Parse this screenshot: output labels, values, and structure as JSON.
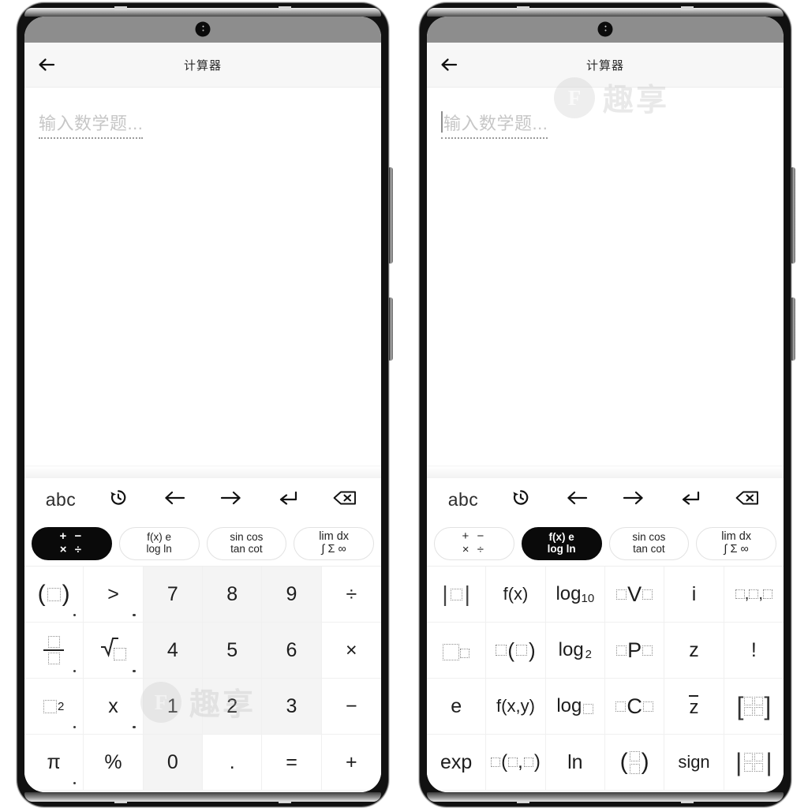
{
  "app": {
    "title": "计算器",
    "back_icon": "back-arrow-icon",
    "status_bar": {
      "camera": "front-camera-punch-hole"
    }
  },
  "input": {
    "placeholder": "输入数学题...",
    "value": "",
    "left_has_caret": false,
    "right_has_caret": true
  },
  "keyboard": {
    "nav": [
      {
        "id": "abc",
        "label": "abc",
        "icon": ""
      },
      {
        "id": "history",
        "label": "",
        "icon": "history-clock-icon"
      },
      {
        "id": "cursor-left",
        "label": "",
        "icon": "arrow-left-icon"
      },
      {
        "id": "cursor-right",
        "label": "",
        "icon": "arrow-right-icon"
      },
      {
        "id": "enter",
        "label": "",
        "icon": "enter-return-icon"
      },
      {
        "id": "backspace",
        "label": "",
        "icon": "backspace-delete-icon"
      }
    ],
    "categories": [
      {
        "id": "basic-ops",
        "line1": "+ −",
        "line2": "× ÷",
        "active_left": true,
        "active_right": false
      },
      {
        "id": "functions",
        "line1": "f(x)  e",
        "line2": "log  ln",
        "active_left": false,
        "active_right": true
      },
      {
        "id": "trig",
        "line1": "sin cos",
        "line2": "tan cot",
        "active_left": false,
        "active_right": false
      },
      {
        "id": "calculus",
        "line1": "lim  dx",
        "line2": "∫ Σ ∞",
        "active_left": false,
        "active_right": false
      }
    ],
    "left_pad": {
      "columns": 6,
      "rows": [
        [
          {
            "label": "(□)",
            "kind": "icon-paren",
            "dot": true,
            "shaded": false
          },
          {
            "label": ">",
            "kind": "text",
            "dot": true,
            "shaded": false
          },
          {
            "label": "7",
            "kind": "text",
            "dot": false,
            "shaded": true
          },
          {
            "label": "8",
            "kind": "text",
            "dot": false,
            "shaded": true
          },
          {
            "label": "9",
            "kind": "text",
            "dot": false,
            "shaded": true
          },
          {
            "label": "÷",
            "kind": "text",
            "dot": false,
            "shaded": false
          }
        ],
        [
          {
            "label": "□/□",
            "kind": "icon-frac",
            "dot": true,
            "shaded": false
          },
          {
            "label": "√□",
            "kind": "icon-sqrt",
            "dot": true,
            "shaded": false
          },
          {
            "label": "4",
            "kind": "text",
            "dot": false,
            "shaded": true
          },
          {
            "label": "5",
            "kind": "text",
            "dot": false,
            "shaded": true
          },
          {
            "label": "6",
            "kind": "text",
            "dot": false,
            "shaded": true
          },
          {
            "label": "×",
            "kind": "text",
            "dot": false,
            "shaded": false
          }
        ],
        [
          {
            "label": "□²",
            "kind": "icon-square",
            "dot": true,
            "shaded": false
          },
          {
            "label": "x",
            "kind": "text",
            "dot": true,
            "shaded": false
          },
          {
            "label": "1",
            "kind": "text",
            "dot": false,
            "shaded": true
          },
          {
            "label": "2",
            "kind": "text",
            "dot": false,
            "shaded": true
          },
          {
            "label": "3",
            "kind": "text",
            "dot": false,
            "shaded": true
          },
          {
            "label": "−",
            "kind": "text",
            "dot": false,
            "shaded": false
          }
        ],
        [
          {
            "label": "π",
            "kind": "text",
            "dot": true,
            "shaded": false
          },
          {
            "label": "%",
            "kind": "text",
            "dot": false,
            "shaded": false
          },
          {
            "label": "0",
            "kind": "text",
            "dot": false,
            "shaded": true
          },
          {
            "label": ".",
            "kind": "text",
            "dot": false,
            "shaded": false
          },
          {
            "label": "=",
            "kind": "text",
            "dot": false,
            "shaded": false
          },
          {
            "label": "+",
            "kind": "text",
            "dot": false,
            "shaded": false
          }
        ]
      ]
    },
    "right_pad": {
      "columns": 6,
      "rows": [
        [
          {
            "label": "|□|",
            "kind": "icon-abs",
            "dot": false,
            "shaded": false
          },
          {
            "label": "f(x)",
            "kind": "text",
            "dot": false,
            "shaded": false
          },
          {
            "label": "log₁₀",
            "kind": "icon-log10",
            "dot": false,
            "shaded": false
          },
          {
            "label": "□V□",
            "kind": "icon-nvr",
            "dot": false,
            "shaded": false
          },
          {
            "label": "i",
            "kind": "text",
            "dot": false,
            "shaded": false
          },
          {
            "label": "□,□,□",
            "kind": "icon-list",
            "dot": false,
            "shaded": false
          }
        ],
        [
          {
            "label": "□^□",
            "kind": "icon-pow",
            "dot": false,
            "shaded": false
          },
          {
            "label": "□(□)",
            "kind": "icon-fn1",
            "dot": false,
            "shaded": false
          },
          {
            "label": "log₂",
            "kind": "icon-log2",
            "dot": false,
            "shaded": false
          },
          {
            "label": "□P□",
            "kind": "icon-perm",
            "dot": false,
            "shaded": false
          },
          {
            "label": "z",
            "kind": "text",
            "dot": false,
            "shaded": false
          },
          {
            "label": "!",
            "kind": "text",
            "dot": false,
            "shaded": false
          }
        ],
        [
          {
            "label": "e",
            "kind": "text",
            "dot": false,
            "shaded": false
          },
          {
            "label": "f(x,y)",
            "kind": "text",
            "dot": false,
            "shaded": false
          },
          {
            "label": "log□",
            "kind": "icon-logn",
            "dot": false,
            "shaded": false
          },
          {
            "label": "□C□",
            "kind": "icon-comb",
            "dot": false,
            "shaded": false
          },
          {
            "label": "z̄",
            "kind": "icon-conj",
            "dot": false,
            "shaded": false
          },
          {
            "label": "[□□;□□]",
            "kind": "icon-matrix",
            "dot": false,
            "shaded": false
          }
        ],
        [
          {
            "label": "exp",
            "kind": "text",
            "dot": false,
            "shaded": false
          },
          {
            "label": "□(□,□)",
            "kind": "icon-fn2",
            "dot": false,
            "shaded": false
          },
          {
            "label": "ln",
            "kind": "text",
            "dot": false,
            "shaded": false
          },
          {
            "label": "(□/□)",
            "kind": "icon-binom",
            "dot": false,
            "shaded": false
          },
          {
            "label": "sign",
            "kind": "text",
            "dot": false,
            "shaded": false
          },
          {
            "label": "|□□;□□|",
            "kind": "icon-det",
            "dot": false,
            "shaded": false
          }
        ]
      ]
    }
  },
  "watermark": {
    "badge": "F",
    "text": "趣享"
  },
  "colors": {
    "accent": "#0a0a0a",
    "numpad_shade": "#f4f4f4",
    "appbar": "#f7f7f7",
    "statusbar": "#8d8d8d",
    "placeholder": "#c6c6c6"
  }
}
